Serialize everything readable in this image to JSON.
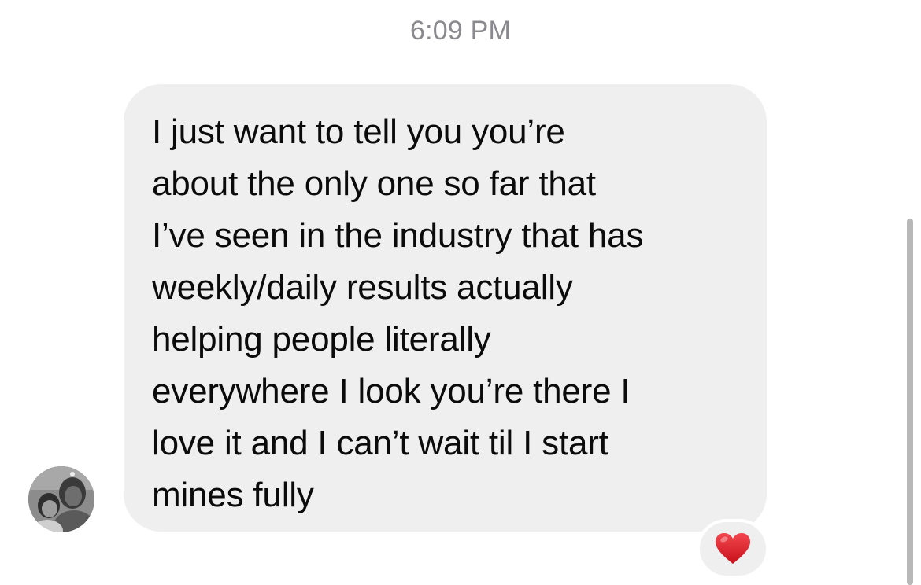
{
  "conversation": {
    "timestamp": "6:09 PM",
    "message": {
      "text": "I just want to tell you you’re\nabout the only one so far that\nI’ve seen in the industry that has\nweekly/daily results actually\nhelping people literally\neverywhere I look you’re there I\nlove it and I can’t wait til I start\nmines fully",
      "reaction_icon": "heart-icon",
      "reaction_color": "#e0222a",
      "bubble_color": "#efefef"
    },
    "sender": {
      "avatar_icon": "avatar"
    }
  }
}
